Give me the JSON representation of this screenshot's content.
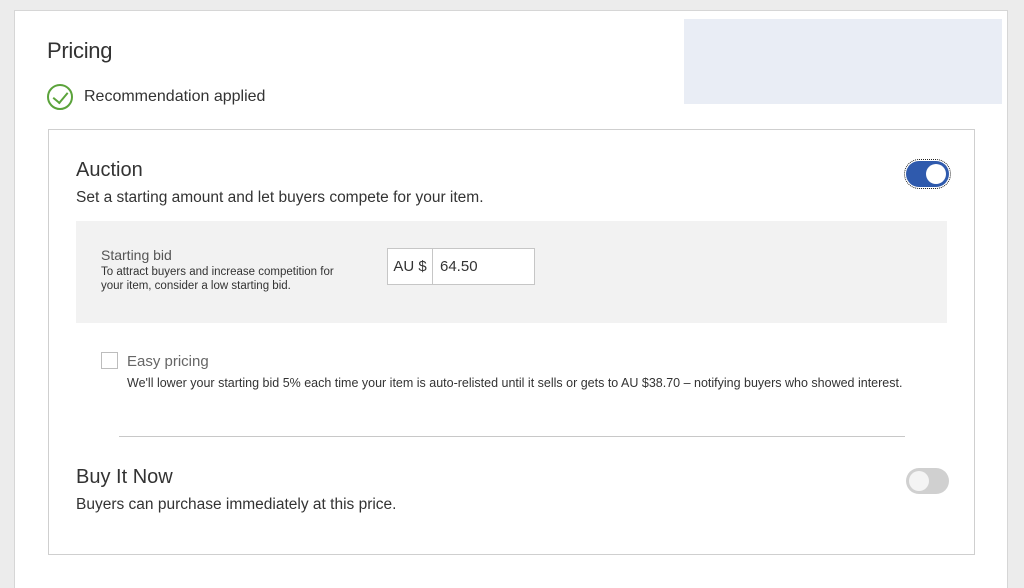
{
  "pricing": {
    "title": "Pricing",
    "recommendation": "Recommendation applied"
  },
  "auction": {
    "title": "Auction",
    "description": "Set a starting amount and let buyers compete for your item.",
    "enabled": true,
    "starting_bid": {
      "label": "Starting bid",
      "help": "To attract buyers and increase competition for your item, consider a low starting bid.",
      "currency": "AU $",
      "value": "64.50"
    },
    "easy_pricing": {
      "label": "Easy pricing",
      "checked": false,
      "description": "We'll lower your starting bid 5% each time your item is auto-relisted until it sells or gets to AU $38.70 – notifying buyers who showed interest."
    }
  },
  "buy_it_now": {
    "title": "Buy It Now",
    "description": "Buyers can purchase immediately at this price.",
    "enabled": false
  },
  "colors": {
    "accent": "#2f5aad",
    "success": "#5ba33b",
    "banner": "#e9edf5"
  }
}
